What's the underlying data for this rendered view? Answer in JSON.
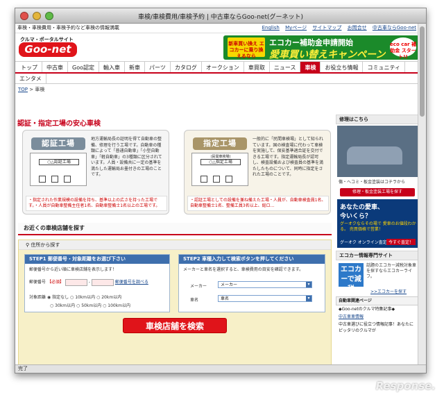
{
  "window": {
    "title": "車検/車検費用/車検予約 | 中古車ならGoo-net(グーネット)",
    "status": "完了"
  },
  "topbar": {
    "tagline": "車検・車検費用・車検予約など車検の情報満載",
    "links": [
      "English",
      "Myページ",
      "サイトマップ",
      "お問合せ",
      "中古車ならGoo-net"
    ]
  },
  "header": {
    "logo_sub": "クルマ・ポータルサイト",
    "logo": "Goo-net",
    "banner": {
      "badge": "新車買い換え エコカーに乗り換えるなら",
      "line1": "エコカー補助金申請開始",
      "line2": "愛車買い替えキャンペーン",
      "seal": "eco car 補助金 スタート!!"
    }
  },
  "nav": {
    "items": [
      "トップ",
      "中古車",
      "Goo認定",
      "輸入車",
      "新車",
      "パーツ",
      "カタログ",
      "オークション",
      "車買取",
      "ニュース",
      "車検",
      "お役立ち情報",
      "コミュニティ"
    ],
    "row2": [
      "エンタメ"
    ]
  },
  "breadcrumb": {
    "top": "TOP",
    "sep": ">",
    "current": "車検"
  },
  "main": {
    "title": "認証・指定工場の安心車検",
    "cards": [
      {
        "label": "認証工場",
        "sign": "○△認証工場",
        "sub": "",
        "text": "地方運輸局長の証明を得て自動車の整備、修理を行う工場です。自動車の種類によって「普通自動車」「小型自動車」「軽自動車」の3種類に区分されています。人員・設備共に一定の基準を満たした運輸局お墨付きの工場のことです。",
        "note": "・指定された作業規模の設備を持ち、基準以上の広さを持った工場です。・人員が自動車整備主任者1名、自動車整備士1名以上の工場です。"
      },
      {
        "label": "指定工場",
        "sign": "○△指定工場",
        "sub": "(民間車検場)",
        "text": "一般的に「民間車検場」として知られています。国の検査場に代わって車検を実施して、保安基準適合証を交付できる工場です。指定運輸局長が認可し、検査設備および検査員の基準を満たしたものについて、同時に指定をされた工場のことです。",
        "note": "・認証工場としての設備を兼ね備えた工場・人員が、自動車検査員1名、自動車整備士1名、整備工員3名以上、総ロ…"
      }
    ],
    "section": "お近くの車検店舗を探す",
    "search_header": "住所から探す",
    "step1": {
      "title": "STEP1 郵便番号・対象距離をお選び下さい",
      "hint": "郵便番号から近い順に車検店舗を表示します！",
      "zip_label": "郵便番号",
      "required": "【必須】",
      "zip_sep": "-",
      "zip_link": "郵便番号を調べる",
      "radius_label": "対象距離",
      "options": [
        "指定なし",
        "10km以内",
        "20km以内",
        "30km以内",
        "50km以内",
        "100km以内"
      ]
    },
    "step2": {
      "title": "STEP2 車種入力して検索ボタンを押してください",
      "hint": "メーカーと車名を選択すると、車検費用の目安を確認できます。",
      "maker_label": "メーカー",
      "maker_value": "メーカー",
      "car_label": "車名",
      "car_value": "車名"
    },
    "search_button": "車検店舗を検索"
  },
  "side": {
    "repair_title": "修理はこちら",
    "repair_text": "傷・ヘコミ・板金塗装はコチラから",
    "repair_btn": "修理・板金塗装工場を探す",
    "ad": {
      "l1": "あなたの愛車、",
      "l2": "今いくら？",
      "l3": "グーオクならその場で 愛車のお値段わかる。 売買価格で営業！",
      "l4": "グーオク オンライン査定",
      "l5": "今すぐ査定！"
    },
    "eco_title": "エコカー情報専門サイト",
    "eco_badge": "エコカーで減税",
    "eco_text": "話題のエコカー減税対象車を探すならエコカーライフ。",
    "eco_link": ">>エコカーを探す",
    "related_title": "自動車関連ページ",
    "related_head": "◆Goo-netのクルマ特集記事◆",
    "related_link": "中古車車情報",
    "related_text": "中古車選びに役立つ情報記事！あなたにピッタリのクルマが"
  },
  "watermark": "Response."
}
